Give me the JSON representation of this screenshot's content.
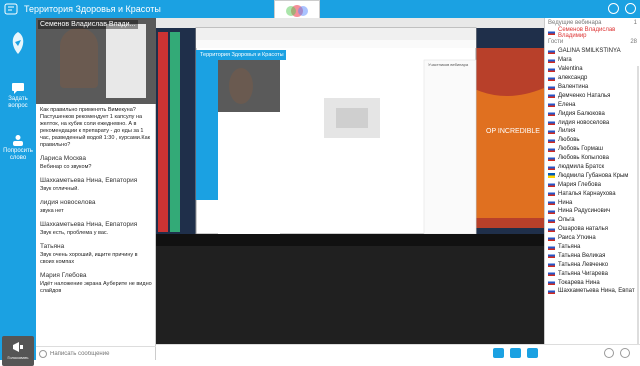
{
  "app": {
    "title": "Территория Здоровья и Красоты"
  },
  "nav": {
    "ask_question": "Задать вопрос",
    "request_word": "Попросить слово",
    "speaker_label": "Голосовать"
  },
  "presenter": {
    "name": "Семенов Владислав Влади..."
  },
  "chat": {
    "messages": [
      {
        "who": "",
        "text": "Как правильно применять Вимекуна? Пастушенков рекомендует 1 капсулу на желток, на кубик соли ежедневно. А в рекомендации к препарату - до еды за 1 час, разведенный водой 1:30 , курсами.Как правильно?"
      },
      {
        "who": "Лариса Москва",
        "text": "Вебинар со звуком?"
      },
      {
        "who": "Шахкаметьева Нина, Евпатория",
        "text": "Звук отличный."
      },
      {
        "who": "лидия новоселова",
        "text": "звука нет"
      },
      {
        "who": "Шахкаметьева Нина, Евпатория",
        "text": "Звук есть, проблема у вас."
      },
      {
        "who": "Татьяна",
        "text": "Звук очень хороший, ищите причину в своих компах"
      },
      {
        "who": "Мария Глебова",
        "text": "Идёт наложение экрана Ауберите не видно слайдов"
      }
    ],
    "input_placeholder": "Написать сообщение"
  },
  "participants": {
    "leaders_label": "Ведущие вебинара",
    "leaders_count": "1",
    "leader": "Семенов Владислав Владимир",
    "guests_label": "Гости",
    "guests_count": "28",
    "list": [
      "GALINA SMILKSTINYA",
      "Mara",
      "Valentina",
      "александр",
      "Валентина",
      "Демченко Наталья",
      "Елена",
      "Лидия Балюкова",
      "лидия новоселова",
      "Лилия",
      "Любовь",
      "Любовь Гормаш",
      "Любовь Копылова",
      "людмила Братск",
      "Людмила Губанова Крым",
      "Мария Глебова",
      "Наталья Карнаухова",
      "Нина",
      "Нина Радусинович",
      "Ольга",
      "Ошарова наталья",
      "Раиса Уткина",
      "Татьяна",
      "Татьяна Великая",
      "Татьяна Левченко",
      "Татьяна Чигарева",
      "Токарева Нина",
      "Шахкаметьева Нина, Евпат"
    ]
  },
  "screen_share": {
    "inner_title": "Территория Здоровья и Красоты",
    "banner_text": "OP INCREDIBLE",
    "inner_chat_preview": "Участников вебинара"
  }
}
